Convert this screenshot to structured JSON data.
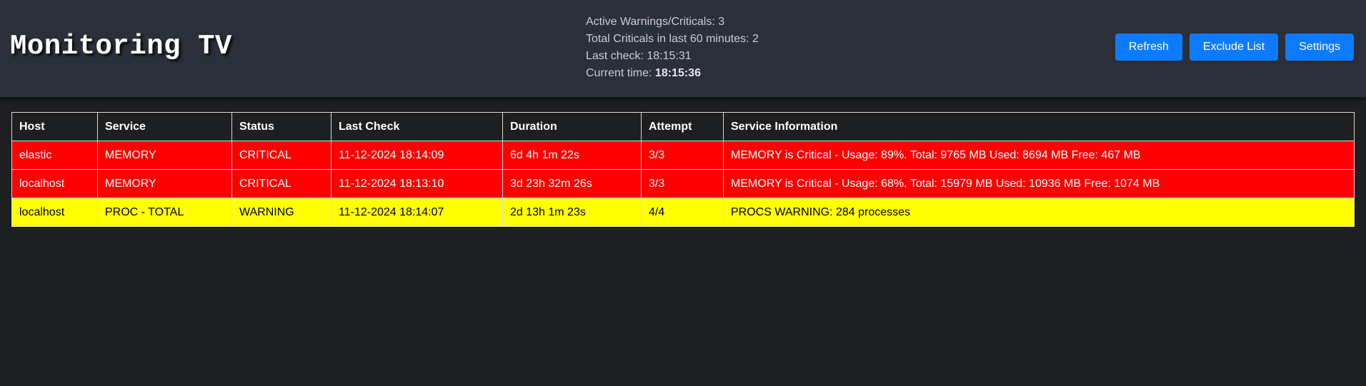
{
  "header": {
    "title": "Monitoring TV",
    "stats": {
      "active_label": "Active Warnings/Criticals: ",
      "active_value": "3",
      "criticals_label": "Total Criticals in last 60 minutes: ",
      "criticals_value": "2",
      "last_check_label": "Last check: ",
      "last_check_value": "18:15:31",
      "current_time_label": "Current time: ",
      "current_time_value": "18:15:36"
    },
    "buttons": {
      "refresh": "Refresh",
      "exclude": "Exclude List",
      "settings": "Settings"
    }
  },
  "colors": {
    "critical": "#ff0000",
    "warning": "#ffff00",
    "button": "#0d7bff",
    "background": "#1e1f21",
    "header_bg": "#2a2f39"
  },
  "table": {
    "columns": [
      "Host",
      "Service",
      "Status",
      "Last Check",
      "Duration",
      "Attempt",
      "Service Information"
    ],
    "rows": [
      {
        "host": "elastic",
        "service": "MEMORY",
        "status": "CRITICAL",
        "last_check": "11-12-2024 18:14:09",
        "duration": "6d 4h 1m 22s",
        "attempt": "3/3",
        "info": "MEMORY is Critical - Usage: 89%. Total: 9765 MB Used: 8694 MB Free: 467 MB"
      },
      {
        "host": "localhost",
        "service": "MEMORY",
        "status": "CRITICAL",
        "last_check": "11-12-2024 18:13:10",
        "duration": "3d 23h 32m 26s",
        "attempt": "3/3",
        "info": "MEMORY is Critical - Usage: 68%. Total: 15979 MB Used: 10936 MB Free: 1074 MB"
      },
      {
        "host": "localhost",
        "service": "PROC - TOTAL",
        "status": "WARNING",
        "last_check": "11-12-2024 18:14:07",
        "duration": "2d 13h 1m 23s",
        "attempt": "4/4",
        "info": "PROCS WARNING: 284 processes"
      }
    ]
  }
}
